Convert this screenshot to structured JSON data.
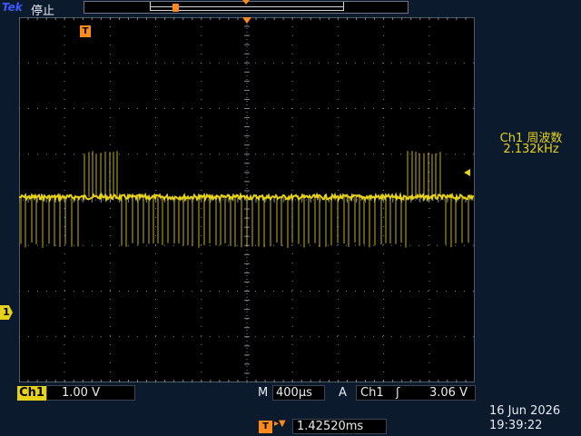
{
  "header": {
    "brand": "Tek",
    "status": "停止",
    "trigger_marker": "T"
  },
  "colors": {
    "trace": "#e6d21a",
    "trigger": "#ff8a1c",
    "grid": "#7b8694",
    "background": "#0b1a2d"
  },
  "channel": {
    "marker": "1",
    "name": "Ch1",
    "scale": "1.00 V"
  },
  "measurement": {
    "label": "Ch1 周波数",
    "value": "2.132kHz"
  },
  "timebase": {
    "label": "M",
    "value": "400µs"
  },
  "trigger": {
    "mode": "A",
    "source": "Ch1",
    "edge_icon": "rising-edge-icon",
    "edge_glyph": "ʃ",
    "level": "3.06 V",
    "position_badge": "T",
    "position_arrow": "▸▼",
    "position": "1.42520ms"
  },
  "clock": {
    "date": "16 Jun  2026",
    "time": "19:39:22"
  }
}
